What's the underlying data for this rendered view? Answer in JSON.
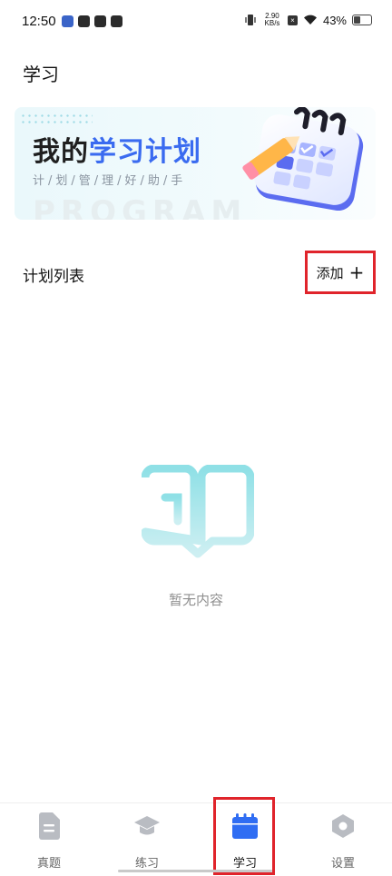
{
  "status_bar": {
    "time": "12:50",
    "net_speed_value": "2.90",
    "net_speed_unit": "KB/s",
    "battery_percent": "43%",
    "left_icons": [
      "app-notification-icon",
      "mail-icon",
      "link-icon",
      "tiktok-icon"
    ],
    "right_icons": [
      "vibrate-icon",
      "wifi-icon",
      "battery-icon"
    ]
  },
  "header": {
    "title": "学习"
  },
  "banner": {
    "title_dark": "我的",
    "title_accent": "学习计划",
    "subtitle": "计/划/管/理/好/助/手",
    "watermark": "PROGRAM",
    "accent_color": "#3a6bf0"
  },
  "plan_section": {
    "title": "计划列表",
    "add_label": "添加",
    "add_icon": "+"
  },
  "empty_state": {
    "icon": "open-book-icon",
    "text": "暂无内容"
  },
  "tabbar": {
    "tabs": [
      {
        "label": "真题",
        "icon": "document-icon",
        "active": false
      },
      {
        "label": "练习",
        "icon": "graduation-cap-icon",
        "active": false
      },
      {
        "label": "学习",
        "icon": "calendar-icon",
        "active": true
      },
      {
        "label": "设置",
        "icon": "hexagon-settings-icon",
        "active": false
      }
    ],
    "active_color": "#2f6df3",
    "inactive_color": "#b9bcc2"
  }
}
